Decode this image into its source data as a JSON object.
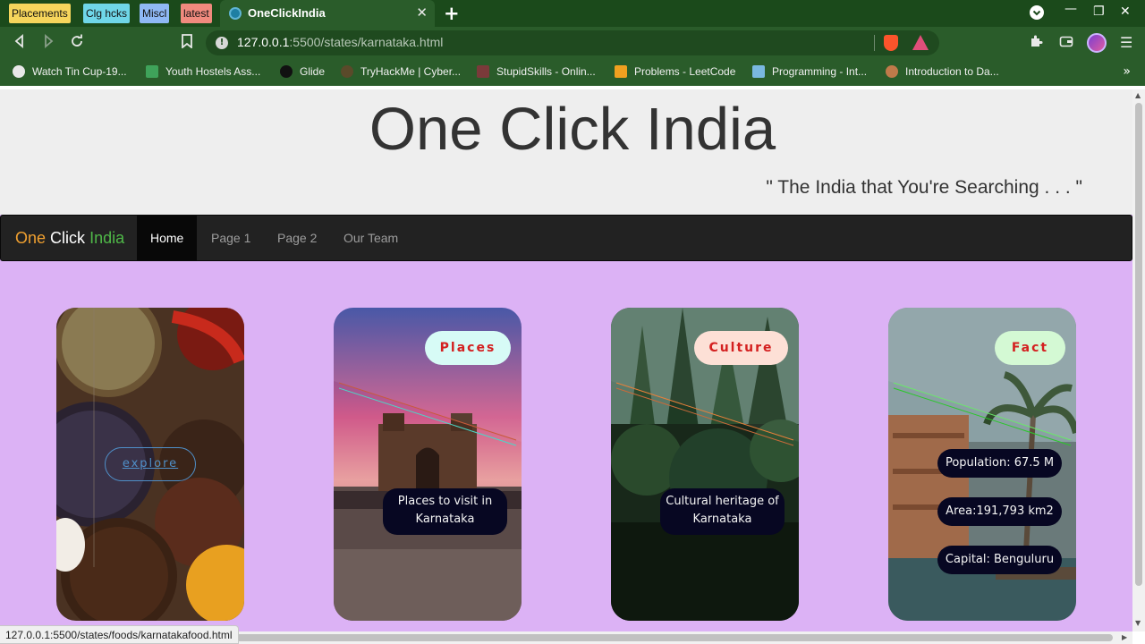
{
  "browser": {
    "tab_groups": [
      {
        "label": "Placements",
        "color": "#f6d55c"
      },
      {
        "label": "Clg hcks",
        "color": "#6fd6e8"
      },
      {
        "label": "Miscl",
        "color": "#8fb8f5"
      },
      {
        "label": "latest",
        "color": "#f08a7e"
      }
    ],
    "active_tab_title": "OneClickIndia",
    "url_host": "127.0.0.1",
    "url_path": ":5500/states/karnataka.html",
    "bookmarks": [
      {
        "label": "Watch Tin Cup-19...",
        "icon": "globe-icon",
        "color": "#e8e8e8"
      },
      {
        "label": "Youth Hostels Ass...",
        "icon": "hostel-icon",
        "color": "#3fa35a"
      },
      {
        "label": "Glide",
        "icon": "glide-icon",
        "color": "#222222"
      },
      {
        "label": "TryHackMe | Cyber...",
        "icon": "tryhackme-icon",
        "color": "#5a4a2a"
      },
      {
        "label": "StupidSkills - Onlin...",
        "icon": "stupidskills-icon",
        "color": "#7a3a3a"
      },
      {
        "label": "Problems - LeetCode",
        "icon": "leetcode-icon",
        "color": "#f0a020"
      },
      {
        "label": "Programming - Int...",
        "icon": "programming-icon",
        "color": "#7ab8e0"
      },
      {
        "label": "Introduction to Da...",
        "icon": "person-icon",
        "color": "#c07a4a"
      }
    ],
    "status_url": "127.0.0.1:5500/states/foods/karnatakafood.html"
  },
  "page": {
    "title": "One Click India",
    "tagline": "\" The India that You're Searching . . . \"",
    "brand": {
      "one": "One",
      "click": "Click",
      "india": "India"
    },
    "nav": [
      "Home",
      "Page 1",
      "Page 2",
      "Our Team"
    ],
    "active_nav": "Home"
  },
  "cards": {
    "food": {
      "explore": "explore"
    },
    "places": {
      "badge": "Places",
      "badge_color": "#d7fbf6",
      "text": "Places to visit in Karnataka"
    },
    "culture": {
      "badge": "Culture",
      "badge_color": "#fde0d6",
      "text": "Cultural heritage of Karnataka"
    },
    "fact": {
      "badge": "Fact",
      "badge_color": "#d4f9d4",
      "population": "Population: 67.5 M",
      "area": "Area:191,793 km2",
      "capital": "Capital: Benguluru"
    }
  }
}
